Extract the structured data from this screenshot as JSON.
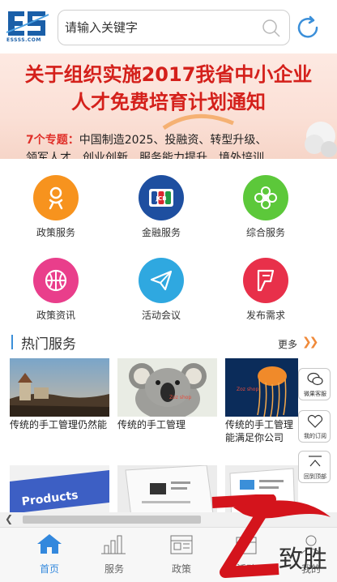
{
  "header": {
    "logo_text": "ESSSS.COM",
    "search_placeholder": "请输入关键字"
  },
  "banner": {
    "line1": "关于组织实施2017我省中小企业",
    "line2": "人才免费培育计划通知",
    "sub_highlight": "7个专题：",
    "sub_rest": "中国制造2025、投融资、转型升级、",
    "sub2": "领军人才、创业创新、服务能力提升、境外培训"
  },
  "grid": {
    "items": [
      {
        "label": "政策服务",
        "color": "#f7931e",
        "icon": "people-icon"
      },
      {
        "label": "金融服务",
        "color": "#1e4fa0",
        "icon": "jcb-card-icon"
      },
      {
        "label": "综合服务",
        "color": "#5cc83a",
        "icon": "flower-icon"
      },
      {
        "label": "政策资讯",
        "color": "#e93e8b",
        "icon": "basketball-icon"
      },
      {
        "label": "活动会议",
        "color": "#2fa8e0",
        "icon": "paper-plane-icon"
      },
      {
        "label": "发布需求",
        "color": "#e8304a",
        "icon": "foursquare-icon"
      }
    ]
  },
  "hot_services": {
    "title": "热门服务",
    "more": "更多",
    "cards": [
      {
        "text": "传统的手工管理仍然能"
      },
      {
        "text": "传统的手工管理"
      },
      {
        "text": "传统的手工管理能满足你公司"
      },
      {
        "text": ""
      },
      {
        "text": ""
      },
      {
        "text": ""
      }
    ],
    "card1_overlay": "Products",
    "shop_tag": "Zoz shop"
  },
  "float_tools": {
    "wechat": "微果客服",
    "subscribe": "我的订阅",
    "top": "回到顶部"
  },
  "bottom_nav": {
    "items": [
      {
        "label": "首页",
        "active": true
      },
      {
        "label": "服务",
        "active": false
      },
      {
        "label": "政策",
        "active": false
      },
      {
        "label": "活动",
        "active": false
      },
      {
        "label": "我的",
        "active": false
      }
    ]
  },
  "watermark": {
    "text": "致胜",
    "letter": "Z"
  },
  "colors": {
    "accent": "#3388dd",
    "banner_red": "#d4201b",
    "more_arrow": "#f08a3a"
  }
}
